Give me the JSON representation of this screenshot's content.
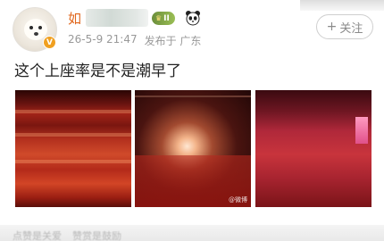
{
  "post": {
    "username": "如",
    "level_badge": "II",
    "meta": {
      "date_time": "26-5-9 21:47",
      "location": "发布于 广东"
    },
    "follow_label": "关注",
    "text": "这个上座率是不是潮早了",
    "photos": [
      {
        "alt": "concert-crowd-1"
      },
      {
        "alt": "concert-stage-2",
        "watermark": "@微博"
      },
      {
        "alt": "concert-crowd-3"
      }
    ],
    "footer": {
      "left": "点赞是关爱",
      "right": "赞赏是鼓励"
    }
  },
  "icons": {
    "verified": "verified-v-icon",
    "panda": "panda-icon",
    "plus": "plus-icon"
  },
  "colors": {
    "username": "#e0661c",
    "meta": "#999999",
    "verified": "#f0a020"
  }
}
